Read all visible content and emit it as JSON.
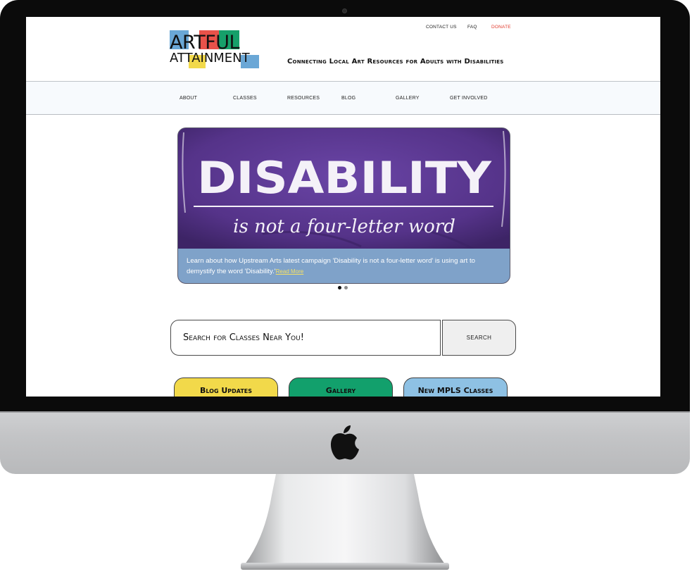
{
  "header": {
    "logo_word1": "ARTFUL",
    "logo_word2": "ATTAINMENT",
    "tagline": "Connecting Local Art Resources for Adults with Disabilities",
    "top_links": [
      "CONTACT US",
      "FAQ",
      "DONATE"
    ],
    "donate_color": "#e23a2c"
  },
  "nav": {
    "items": [
      "ABOUT",
      "CLASSES",
      "RESOURCES",
      "BLOG",
      "GALLERY",
      "GET INVOLVED"
    ]
  },
  "carousel": {
    "shirt_headline": "DISABILITY",
    "shirt_subline": "is not a four-letter word",
    "caption": "Learn about how Upstream Arts latest campaign 'Disability is not a four-letter word' is using art to demystify the word 'Disability.'",
    "read_more": "Read More",
    "slide_count": 2,
    "active_slide": 1
  },
  "search": {
    "placeholder": "Search for Classes Near You!",
    "button_label": "SEARCH"
  },
  "quick_links": [
    {
      "label": "Blog Updates",
      "color": "#f2d94a"
    },
    {
      "label": "Gallery",
      "color": "#12a06c"
    },
    {
      "label": "New MPLS Classes",
      "color": "#8ec1e4"
    }
  ],
  "colors": {
    "logo_blue": "#6aa7d6",
    "logo_red": "#e8524a",
    "logo_green": "#16a06a",
    "logo_yellow": "#f2d94a",
    "caption_bg": "#7fa2c9",
    "shirt_purple": "#5b3993"
  },
  "icons": {
    "apple": "apple-logo-icon",
    "camera": "webcam-icon"
  }
}
